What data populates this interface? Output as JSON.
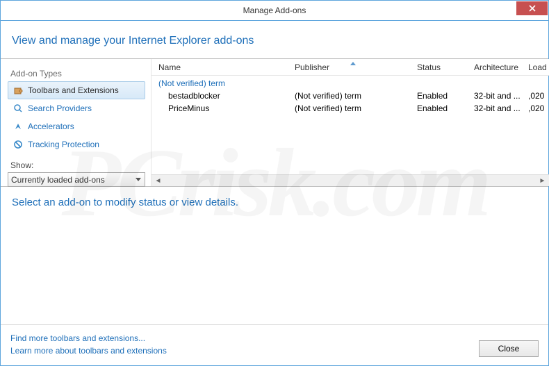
{
  "window": {
    "title": "Manage Add-ons"
  },
  "header": {
    "subtitle": "View and manage your Internet Explorer add-ons"
  },
  "sidebar": {
    "types_label": "Add-on Types",
    "items": [
      {
        "label": "Toolbars and Extensions",
        "selected": true
      },
      {
        "label": "Search Providers",
        "selected": false
      },
      {
        "label": "Accelerators",
        "selected": false
      },
      {
        "label": "Tracking Protection",
        "selected": false
      }
    ],
    "show_label": "Show:",
    "dropdown_value": "Currently loaded add-ons"
  },
  "list": {
    "columns": {
      "name": "Name",
      "publisher": "Publisher",
      "status": "Status",
      "architecture": "Architecture",
      "load": "Load"
    },
    "sort_column": "publisher",
    "group_header": "(Not verified) term",
    "rows": [
      {
        "name": "bestadblocker",
        "publisher": "(Not verified) term",
        "status": "Enabled",
        "architecture": "32-bit and ...",
        "load": ",020"
      },
      {
        "name": "PriceMinus",
        "publisher": "(Not verified) term",
        "status": "Enabled",
        "architecture": "32-bit and ...",
        "load": ",020"
      }
    ]
  },
  "detail": {
    "prompt": "Select an add-on to modify status or view details."
  },
  "footer": {
    "link_find": "Find more toolbars and extensions...",
    "link_learn": "Learn more about toolbars and extensions",
    "close_label": "Close"
  },
  "watermark": "PCrisk.com"
}
